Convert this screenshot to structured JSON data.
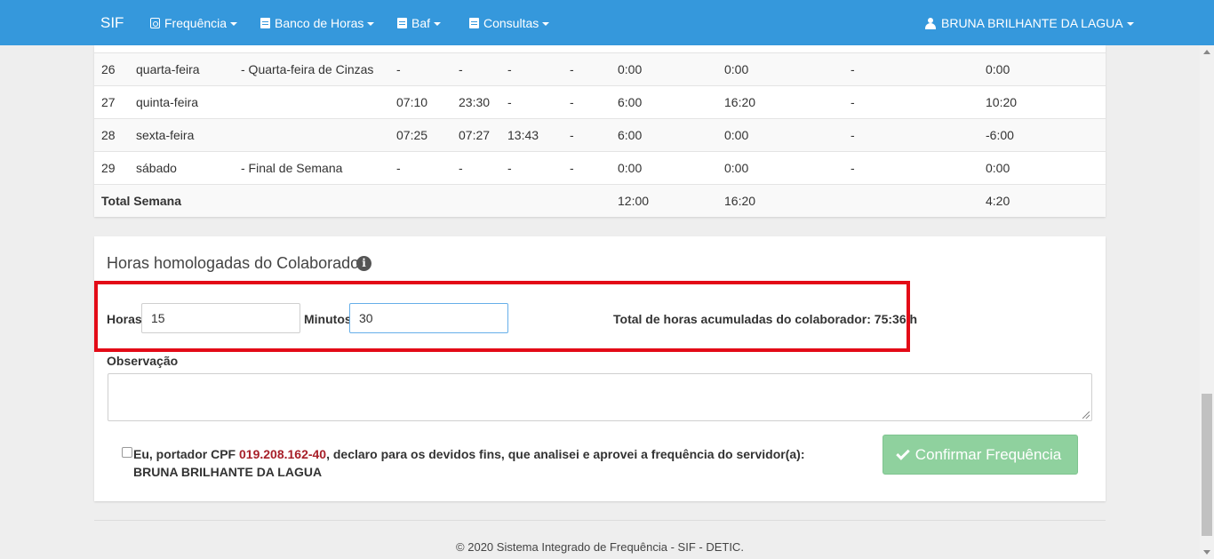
{
  "navbar": {
    "brand": "SIF",
    "items": [
      {
        "label": "Frequência",
        "icon": "calendar-icon"
      },
      {
        "label": "Banco de Horas",
        "icon": "document-icon"
      },
      {
        "label": "Baf",
        "icon": "document-icon"
      },
      {
        "label": "Consultas",
        "icon": "document-icon"
      }
    ],
    "user": "BRUNA BRILHANTE DA LAGUA"
  },
  "table": {
    "rows": [
      {
        "day": "26",
        "weekday": "quarta-feira",
        "note": "- Quarta-feira de Cinzas",
        "e1": "-",
        "s1": "-",
        "e2": "-",
        "s2": "-",
        "prevista": "0:00",
        "trabalhada": "0:00",
        "abono": "-",
        "saldo": "0:00"
      },
      {
        "day": "27",
        "weekday": "quinta-feira",
        "note": "",
        "e1": "07:10",
        "s1": "23:30",
        "e2": "-",
        "s2": "-",
        "prevista": "6:00",
        "trabalhada": "16:20",
        "abono": "-",
        "saldo": "10:20"
      },
      {
        "day": "28",
        "weekday": "sexta-feira",
        "note": "",
        "e1": "07:25",
        "s1": "07:27",
        "e2": "13:43",
        "s2": "-",
        "prevista": "6:00",
        "trabalhada": "0:00",
        "abono": "-",
        "saldo": "-6:00"
      },
      {
        "day": "29",
        "weekday": "sábado",
        "note": "- Final de Semana",
        "e1": "-",
        "s1": "-",
        "e2": "-",
        "s2": "-",
        "prevista": "0:00",
        "trabalhada": "0:00",
        "abono": "-",
        "saldo": "0:00"
      }
    ],
    "total": {
      "label": "Total Semana",
      "prevista": "12:00",
      "trabalhada": "16:20",
      "saldo": "4:20"
    }
  },
  "form": {
    "title": "Horas homologadas do Colaborador",
    "horas_label": "Horas",
    "horas_value": "15",
    "minutos_label": "Minutos",
    "minutos_value": "30",
    "total_text": "Total de horas acumuladas do colaborador: 75:36 h",
    "observacao_label": "Observação",
    "declaration_prefix": "Eu, portador CPF ",
    "cpf": "019.208.162-40",
    "declaration_suffix": ", declaro para os devidos fins, que analisei e aprovei a frequência do servidor(a):",
    "servidor": "BRUNA BRILHANTE DA LAGUA",
    "confirm_label": "Confirmar Frequência"
  },
  "footer": "© 2020 Sistema Integrado de Frequência - SIF - DETIC.",
  "colors": {
    "navbar": "#3598dc",
    "highlight": "#e30b17",
    "confirm": "#8fd19e",
    "cpf": "#a8202a"
  }
}
